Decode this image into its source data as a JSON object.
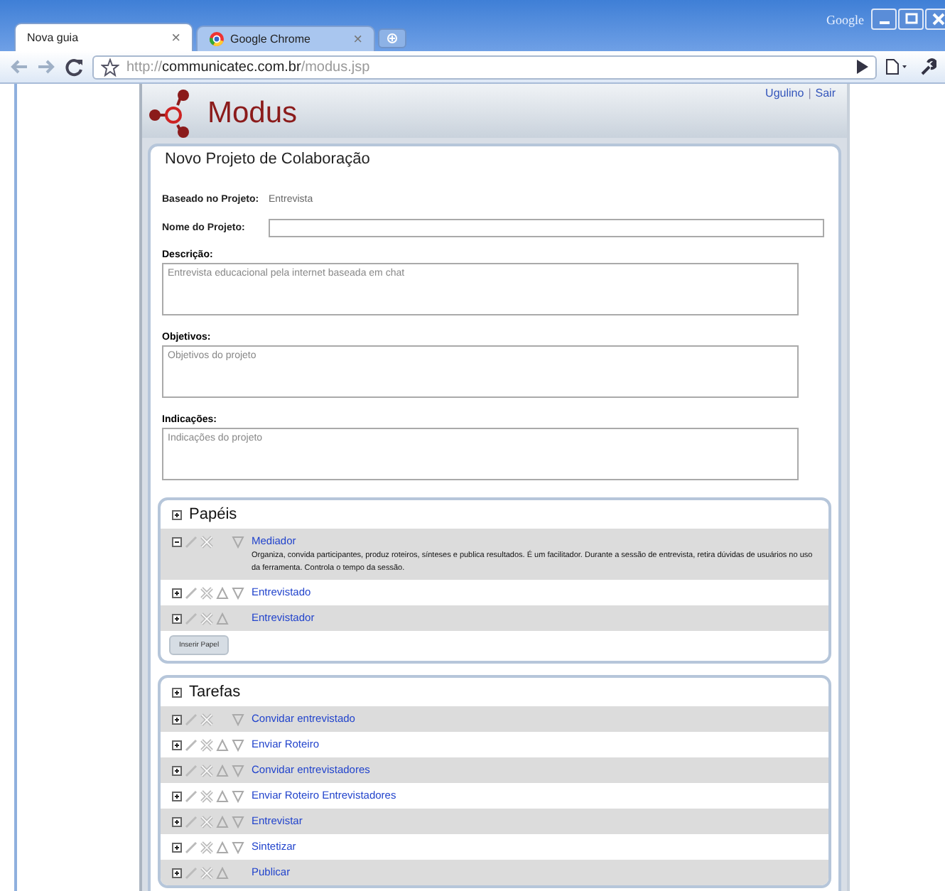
{
  "browser": {
    "tabs": [
      {
        "label": "Nova guia",
        "selected": true,
        "close": "×"
      },
      {
        "label": "Google Chrome",
        "selected": false,
        "close": "×"
      }
    ],
    "brand": "Google",
    "address": {
      "scheme": "http://",
      "host": "communicatec.com.br",
      "path": "/modus.jsp"
    }
  },
  "header": {
    "logo": "Modus",
    "user": "Ugulino",
    "separator": "|",
    "logout": "Sair"
  },
  "form": {
    "title": "Novo Projeto de Colaboração",
    "based_on": {
      "label": "Baseado no Projeto:",
      "value": "Entrevista"
    },
    "name": {
      "label": "Nome do Projeto:"
    },
    "areas": [
      {
        "label": "Descrição:",
        "placeholder": "Entrevista educacional pela internet baseada em chat"
      },
      {
        "label": "Objetivos:",
        "placeholder": "Objetivos do projeto"
      },
      {
        "label": "Indicações:",
        "placeholder": "Indicações do projeto"
      }
    ]
  },
  "sections": [
    {
      "title": "Papéis",
      "button": "Inserir Papel",
      "items": [
        {
          "name": "Mediador",
          "expanded": true,
          "can_move_up": false,
          "can_move_down": true,
          "description": "Organiza, convida participantes, produz roteiros, sínteses e publica resultados. É um facilitador. Durante a sessão de entrevista, retira dúvidas de usuários no uso da ferramenta. Controla o tempo da sessão."
        },
        {
          "name": "Entrevistado",
          "expanded": false,
          "can_move_up": true,
          "can_move_down": true
        },
        {
          "name": "Entrevistador",
          "expanded": false,
          "can_move_up": true,
          "can_move_down": false
        }
      ]
    },
    {
      "title": "Tarefas",
      "items": [
        {
          "name": "Convidar entrevistado",
          "expanded": false,
          "can_move_up": false,
          "can_move_down": true
        },
        {
          "name": "Enviar Roteiro",
          "expanded": false,
          "can_move_up": true,
          "can_move_down": true
        },
        {
          "name": "Convidar entrevistadores",
          "expanded": false,
          "can_move_up": true,
          "can_move_down": true
        },
        {
          "name": "Enviar Roteiro Entrevistadores",
          "expanded": false,
          "can_move_up": true,
          "can_move_down": true
        },
        {
          "name": "Entrevistar",
          "expanded": false,
          "can_move_up": true,
          "can_move_down": true
        },
        {
          "name": "Sintetizar",
          "expanded": false,
          "can_move_up": true,
          "can_move_down": true
        },
        {
          "name": "Publicar",
          "expanded": false,
          "can_move_up": true,
          "can_move_down": false
        }
      ]
    }
  ]
}
